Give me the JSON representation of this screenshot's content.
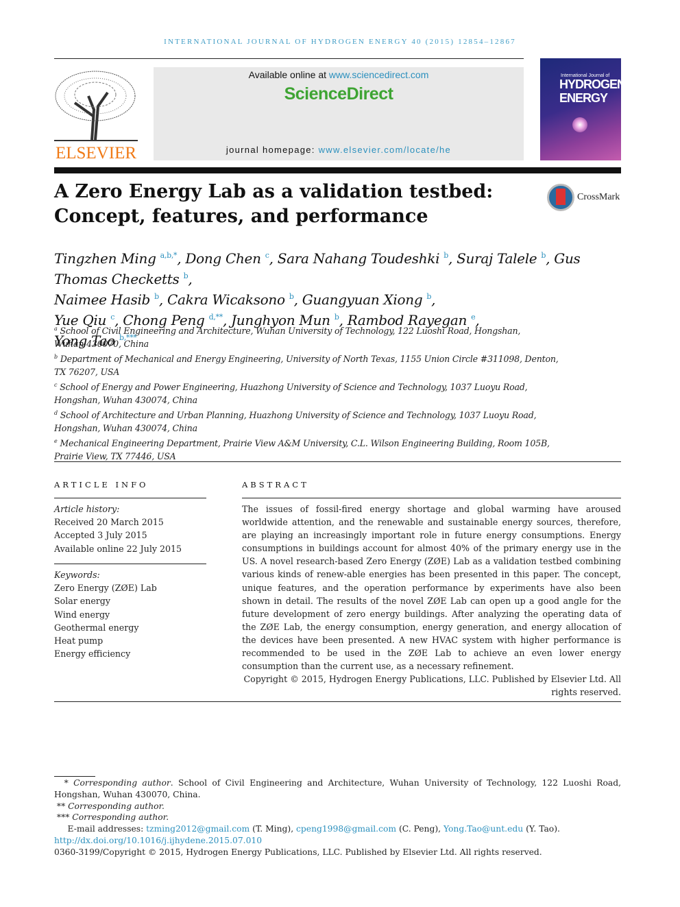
{
  "header": {
    "running_title": "INTERNATIONAL JOURNAL OF HYDROGEN ENERGY 40 (2015) 12854–12867",
    "publisher_logo": "ELSEVIER",
    "available_online_prefix": "Available online at ",
    "available_online_link": "www.sciencedirect.com",
    "platform": "ScienceDirect",
    "homepage_prefix": "journal homepage: ",
    "homepage_link": "www.elsevier.com/locate/he",
    "cover": {
      "small": "International Journal of",
      "title_line1": "HYDROGEN",
      "title_line2": "ENERGY"
    }
  },
  "article": {
    "title": "A Zero Energy Lab as a validation testbed: Concept, features, and performance",
    "crossmark_label": "CrossMark",
    "authors": [
      {
        "name": "Tingzhen Ming",
        "sup": "a,b,*"
      },
      {
        "name": "Dong Chen",
        "sup": "c"
      },
      {
        "name": "Sara Nahang Toudeshki",
        "sup": "b"
      },
      {
        "name": "Suraj Talele",
        "sup": "b"
      },
      {
        "name": "Gus Thomas Checketts",
        "sup": "b"
      },
      {
        "name": "Naimee Hasib",
        "sup": "b"
      },
      {
        "name": "Cakra Wicaksono",
        "sup": "b"
      },
      {
        "name": "Guangyuan Xiong",
        "sup": "b"
      },
      {
        "name": "Yue Qiu",
        "sup": "c"
      },
      {
        "name": "Chong Peng",
        "sup": "d,**"
      },
      {
        "name": "Junghyon Mun",
        "sup": "b"
      },
      {
        "name": "Rambod Rayegan",
        "sup": "e"
      },
      {
        "name": "Yong Tao",
        "sup": "b,***"
      }
    ],
    "affiliations": [
      {
        "sup": "a",
        "line1": "School of Civil Engineering and Architecture, Wuhan University of Technology, 122 Luoshi Road, Hongshan,",
        "line2": "Wuhan 430070, China"
      },
      {
        "sup": "b",
        "line1": "Department of Mechanical and Energy Engineering, University of North Texas, 1155 Union Circle #311098, Denton,",
        "line2": "TX 76207, USA"
      },
      {
        "sup": "c",
        "line1": "School of Energy and Power Engineering, Huazhong University of Science and Technology, 1037 Luoyu Road,",
        "line2": "Hongshan, Wuhan 430074, China"
      },
      {
        "sup": "d",
        "line1": "School of Architecture and Urban Planning, Huazhong University of Science and Technology, 1037 Luoyu Road,",
        "line2": "Hongshan, Wuhan 430074, China"
      },
      {
        "sup": "e",
        "line1": "Mechanical Engineering Department, Prairie View A&M University, C.L. Wilson Engineering Building, Room 105B,",
        "line2": "Prairie View, TX 77446, USA"
      }
    ]
  },
  "article_info": {
    "heading": "ARTICLE INFO",
    "history_label": "Article history:",
    "history": [
      "Received 20 March 2015",
      "Accepted 3 July 2015",
      "Available online 22 July 2015"
    ],
    "keywords_label": "Keywords:",
    "keywords": [
      "Zero Energy (ZØE) Lab",
      "Solar energy",
      "Wind energy",
      "Geothermal energy",
      "Heat pump",
      "Energy efficiency"
    ]
  },
  "abstract": {
    "heading": "ABSTRACT",
    "text": "The issues of fossil-fired energy shortage and global warming have aroused worldwide attention, and the renewable and sustainable energy sources, therefore, are playing an increasingly important role in future energy consumptions. Energy consumptions in buildings account for almost 40% of the primary energy use in the US. A novel research-based Zero Energy (ZØE) Lab as a validation testbed combining various kinds of renew-able energies has been presented in this paper. The concept, unique features, and the operation performance by experiments have also been shown in detail. The results of the novel ZØE Lab can open up a good angle for the future development of zero energy buildings. After analyzing the operating data of the ZØE Lab, the energy consumption, energy generation, and energy allocation of the devices have been presented. A new HVAC system with higher performance is recommended to be used in the ZØE Lab to achieve an even lower energy consumption than the current use, as a necessary refinement.",
    "copyright": "Copyright © 2015, Hydrogen Energy Publications, LLC. Published by Elsevier Ltd. All rights reserved."
  },
  "footnotes": {
    "fn1_mark": "*",
    "fn1_label": "Corresponding author",
    "fn1_text": ". School of Civil Engineering and Architecture, Wuhan University of Technology, 122 Luoshi Road, Hongshan, Wuhan 430070, China.",
    "fn2_mark": "**",
    "fn2_label": "Corresponding author.",
    "fn3_mark": "***",
    "fn3_label": "Corresponding author.",
    "email_label": "E-mail addresses: ",
    "emails": [
      {
        "address": "tzming2012@gmail.com",
        "who": " (T. Ming), "
      },
      {
        "address": "cpeng1998@gmail.com",
        "who": " (C. Peng), "
      },
      {
        "address": "Yong.Tao@unt.edu",
        "who": " (Y. Tao)."
      }
    ],
    "doi": "http://dx.doi.org/10.1016/j.ijhydene.2015.07.010",
    "issn_copyright": "0360-3199/Copyright © 2015, Hydrogen Energy Publications, LLC. Published by Elsevier Ltd. All rights reserved."
  }
}
